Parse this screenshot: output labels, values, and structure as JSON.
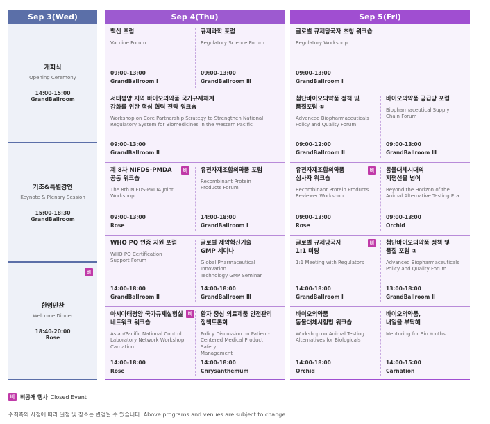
{
  "headers": {
    "d1": "Sep 3(Wed)",
    "d2": "Sep 4(Thu)",
    "d3": "Sep 5(Fri)"
  },
  "day1": [
    {
      "title": "개회식",
      "en": "Opening Ceremony",
      "time": "14:00-15:00",
      "venue": "GrandBallroom"
    },
    {
      "title": "기조&특별강연",
      "en": "Keynote & Plenary Session",
      "time": "15:00-18:30",
      "venue": "GrandBallroom"
    },
    {
      "title": "환영만찬",
      "en": "Welcome Dinner",
      "time": "18:40-20:00",
      "venue": "Rose",
      "badge": "비"
    }
  ],
  "day2": {
    "r1a": {
      "title": "백신 포럼",
      "en": "Vaccine Forum",
      "time": "09:00-13:00",
      "venue": "GrandBallroom Ⅰ"
    },
    "r1b": {
      "title": "규제과학 포럼",
      "en": "Regulatory Science Forum",
      "time": "09:00-13:00",
      "venue": "GrandBallroom Ⅲ"
    },
    "r2": {
      "title1": "서태평양 지역 바이오의약품 국가규제체계",
      "title2": "강화를 위한 핵심 협력 전략 워크숍",
      "en1": "Workshop on Core Partnership Strategy to Strengthen National",
      "en2": "Regulatory System for Biomedicines in the Western Pacific",
      "time": "09:00-13:00",
      "venue": "GrandBallroom Ⅱ"
    },
    "r3a": {
      "title1": "제 8차 NIFDS-PMDA",
      "title2": "공동 워크숍",
      "en1": "The 8th NIFDS-PMDA Joint",
      "en2": "Workshop",
      "time": "09:00-13:00",
      "venue": "Rose",
      "badge": "비"
    },
    "r3b": {
      "title": "유전자재조합의약품 포럼",
      "en1": "Recombinant Protein",
      "en2": "Products Forum",
      "time": "14:00-18:00",
      "venue": "GrandBallroom Ⅰ"
    },
    "r4a": {
      "title": "WHO PQ 인증 지원 포럼",
      "en1": "WHO PQ Certification",
      "en2": "Support Forum",
      "time": "14:00-18:00",
      "venue": "GrandBallroom Ⅱ"
    },
    "r4b": {
      "title1": "글로벌 제약혁신기술",
      "title2": "GMP 세미나",
      "en1": "Global Pharmaceutical Innovation",
      "en2": "Technology GMP Seminar",
      "time": "14:00-18:00",
      "venue": "GrandBallroom Ⅲ"
    },
    "r5a": {
      "title1": "아시아태평양 국가규제실험실",
      "title2": "네트워크 워크숍",
      "en1": "Asian/Pacific National Control",
      "en2": "Laboratory Network Workshop",
      "en3": "Carnation",
      "time": "14:00-18:00",
      "venue": "Rose",
      "badge": "비"
    },
    "r5b": {
      "title1": "환자 중심 의료제품 안전관리",
      "title2": "정책토론회",
      "en1": "Policy Discussion on Patient-",
      "en2": "Centered Medical Product Safety",
      "en3": "Management",
      "time": "14:00-18:00",
      "venue": "Chrysanthemum"
    }
  },
  "day3": {
    "r1": {
      "title": "글로벌 규제당국자 초청 워크숍",
      "en": "Regulatory Workshop",
      "time": "09:00-13:00",
      "venue": "GrandBallroom Ⅰ"
    },
    "r2a": {
      "title1": "첨단바이오의약품 정책 및",
      "title2": "품질포럼 ①",
      "en1": "Advanced Biopharmaceuticals",
      "en2": "Policy and Quality Forum",
      "time": "09:00-12:00",
      "venue": "GrandBallroom Ⅱ"
    },
    "r2b": {
      "title": "바이오의약품 공급망 포럼",
      "en1": "Biopharmaceutical Supply",
      "en2": "Chain Forum",
      "time": "09:00-13:00",
      "venue": "GrandBallroom Ⅲ"
    },
    "r3a": {
      "title1": "유전자재조합의약품",
      "title2": "심사자 워크숍",
      "en1": "Recombinant Protein Products",
      "en2": "Reviewer Workshop",
      "time": "09:00-13:00",
      "venue": "Rose",
      "badge": "비"
    },
    "r3b": {
      "title1": "동물대체시대의",
      "title2": "지평선을 넘어",
      "en1": "Beyond the Horizon of the",
      "en2": "Animal Alternative Testing Era",
      "time": "09:00-13:00",
      "venue": "Orchid"
    },
    "r4a": {
      "title1": "글로벌 규제당국자",
      "title2": "1:1 미팅",
      "en": "1:1 Meeting with Regulators",
      "time": "14:00-18:00",
      "venue": "GrandBallroom Ⅰ",
      "badge": "비"
    },
    "r4b": {
      "title1": "첨단바이오의약품 정책 및",
      "title2": "품질 포럼 ②",
      "en1": "Advanced Biopharmaceuticals",
      "en2": "Policy and Quality Forum",
      "time": "13:00-18:00",
      "venue": "GrandBallroom Ⅱ"
    },
    "r5a": {
      "title1": "바이오의약품",
      "title2": "동물대체시험법 워크숍",
      "en1": "Workshop on Animal Testing",
      "en2": "Alternatives for Biologicals",
      "time": "14:00-18:00",
      "venue": "Orchid"
    },
    "r5b": {
      "title1": "바이오의약품,",
      "title2": "내일을 부탁해",
      "en": "Mentoring for Bio Youths",
      "time": "14:00-15:00",
      "venue": "Carnation"
    }
  },
  "legend": {
    "badge": "비",
    "ko": "비공개 행사",
    "en": "Closed Event"
  },
  "note": "주최측의 사정에 따라 일정 및 장소는 변경될 수 있습니다. Above programs and venues are subject to change.",
  "colors": {
    "day1": "#5b6fa8",
    "day2": "#9d5ad0",
    "day3": "#a04ed1",
    "badge": "#c03aa8"
  }
}
